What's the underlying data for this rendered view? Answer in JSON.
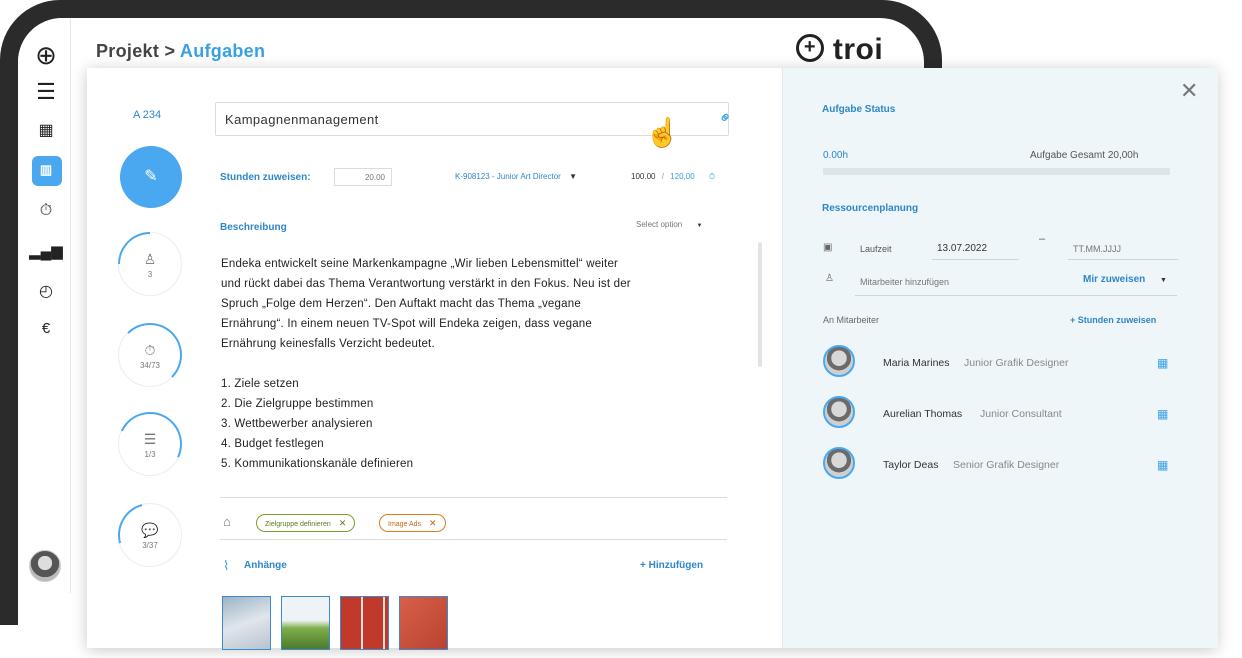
{
  "breadcrumb": {
    "project": "Projekt",
    "separator": ">",
    "current": "Aufgaben"
  },
  "logo": {
    "text": "troi"
  },
  "task": {
    "id": "A 234",
    "title": "Kampagnenmanagement",
    "hours_label": "Stunden zuweisen:",
    "hours_placeholder": "20.00",
    "assignment": "K-908123 - Junior Art Director",
    "hours_used": "100.00",
    "hours_sep": "/",
    "hours_total": "120,00",
    "description_label": "Beschreibung",
    "select_option": "Select option",
    "description_lines": [
      "Endeka entwickelt seine Markenkampagne „Wir lieben Lebensmittel“ weiter",
      "und rückt dabei das Thema Verantwortung verstärkt in den Fokus. Neu ist der",
      "Spruch „Folge dem Herzen“. Den Auftakt macht das Thema „vegane",
      "Ernährung“. In einem neuen TV-Spot will Endeka zeigen, dass vegane",
      "Ernährung keinesfalls Verzicht bedeutet."
    ],
    "list": [
      "1. Ziele setzen",
      "2. Die Zielgruppe bestimmen",
      "3. Wettbewerber analysieren",
      "4. Budget festlegen",
      "5. Kommunikationskanäle definieren"
    ],
    "tags": [
      {
        "label": "Zielgruppe definieren",
        "color": "#7aa22a"
      },
      {
        "label": "Image Ads",
        "color": "#e47a1a"
      }
    ],
    "attachments_label": "Anhänge",
    "add_label": "+ Hinzufügen"
  },
  "stats": [
    {
      "icon": "user-icon",
      "value": "3",
      "progress": 0.25
    },
    {
      "icon": "stopwatch-icon",
      "value": "34/73",
      "progress": 0.47
    },
    {
      "icon": "list-icon",
      "value": "1/3",
      "progress": 0.33
    },
    {
      "icon": "comment-icon",
      "value": "3/37",
      "progress": 0.08
    }
  ],
  "status": {
    "title": "Aufgabe Status",
    "hours": "0.00h",
    "total": "Aufgabe Gesamt 20,00h",
    "progress": 0
  },
  "resources": {
    "title": "Ressourcenplanung",
    "runtime_label": "Laufzeit",
    "start_date": "13.07.2022",
    "dash": "–",
    "end_placeholder": "TT.MM.JJJJ",
    "add_member_placeholder": "Mitarbeiter hinzufügen",
    "assign_me": "Mir zuweisen",
    "to_label": "An Mitarbeiter",
    "assign_hours": "+ Stunden zuweisen",
    "members": [
      {
        "name": "Maria Marines",
        "role": "Junior Grafik Designer"
      },
      {
        "name": "Aurelian Thomas",
        "role": "Junior Consultant"
      },
      {
        "name": "Taylor Deas",
        "role": "Senior Grafik Designer"
      }
    ]
  },
  "colors": {
    "accent": "#4aa8f0",
    "link": "#2f86c8",
    "panel": "#eef6fa"
  }
}
